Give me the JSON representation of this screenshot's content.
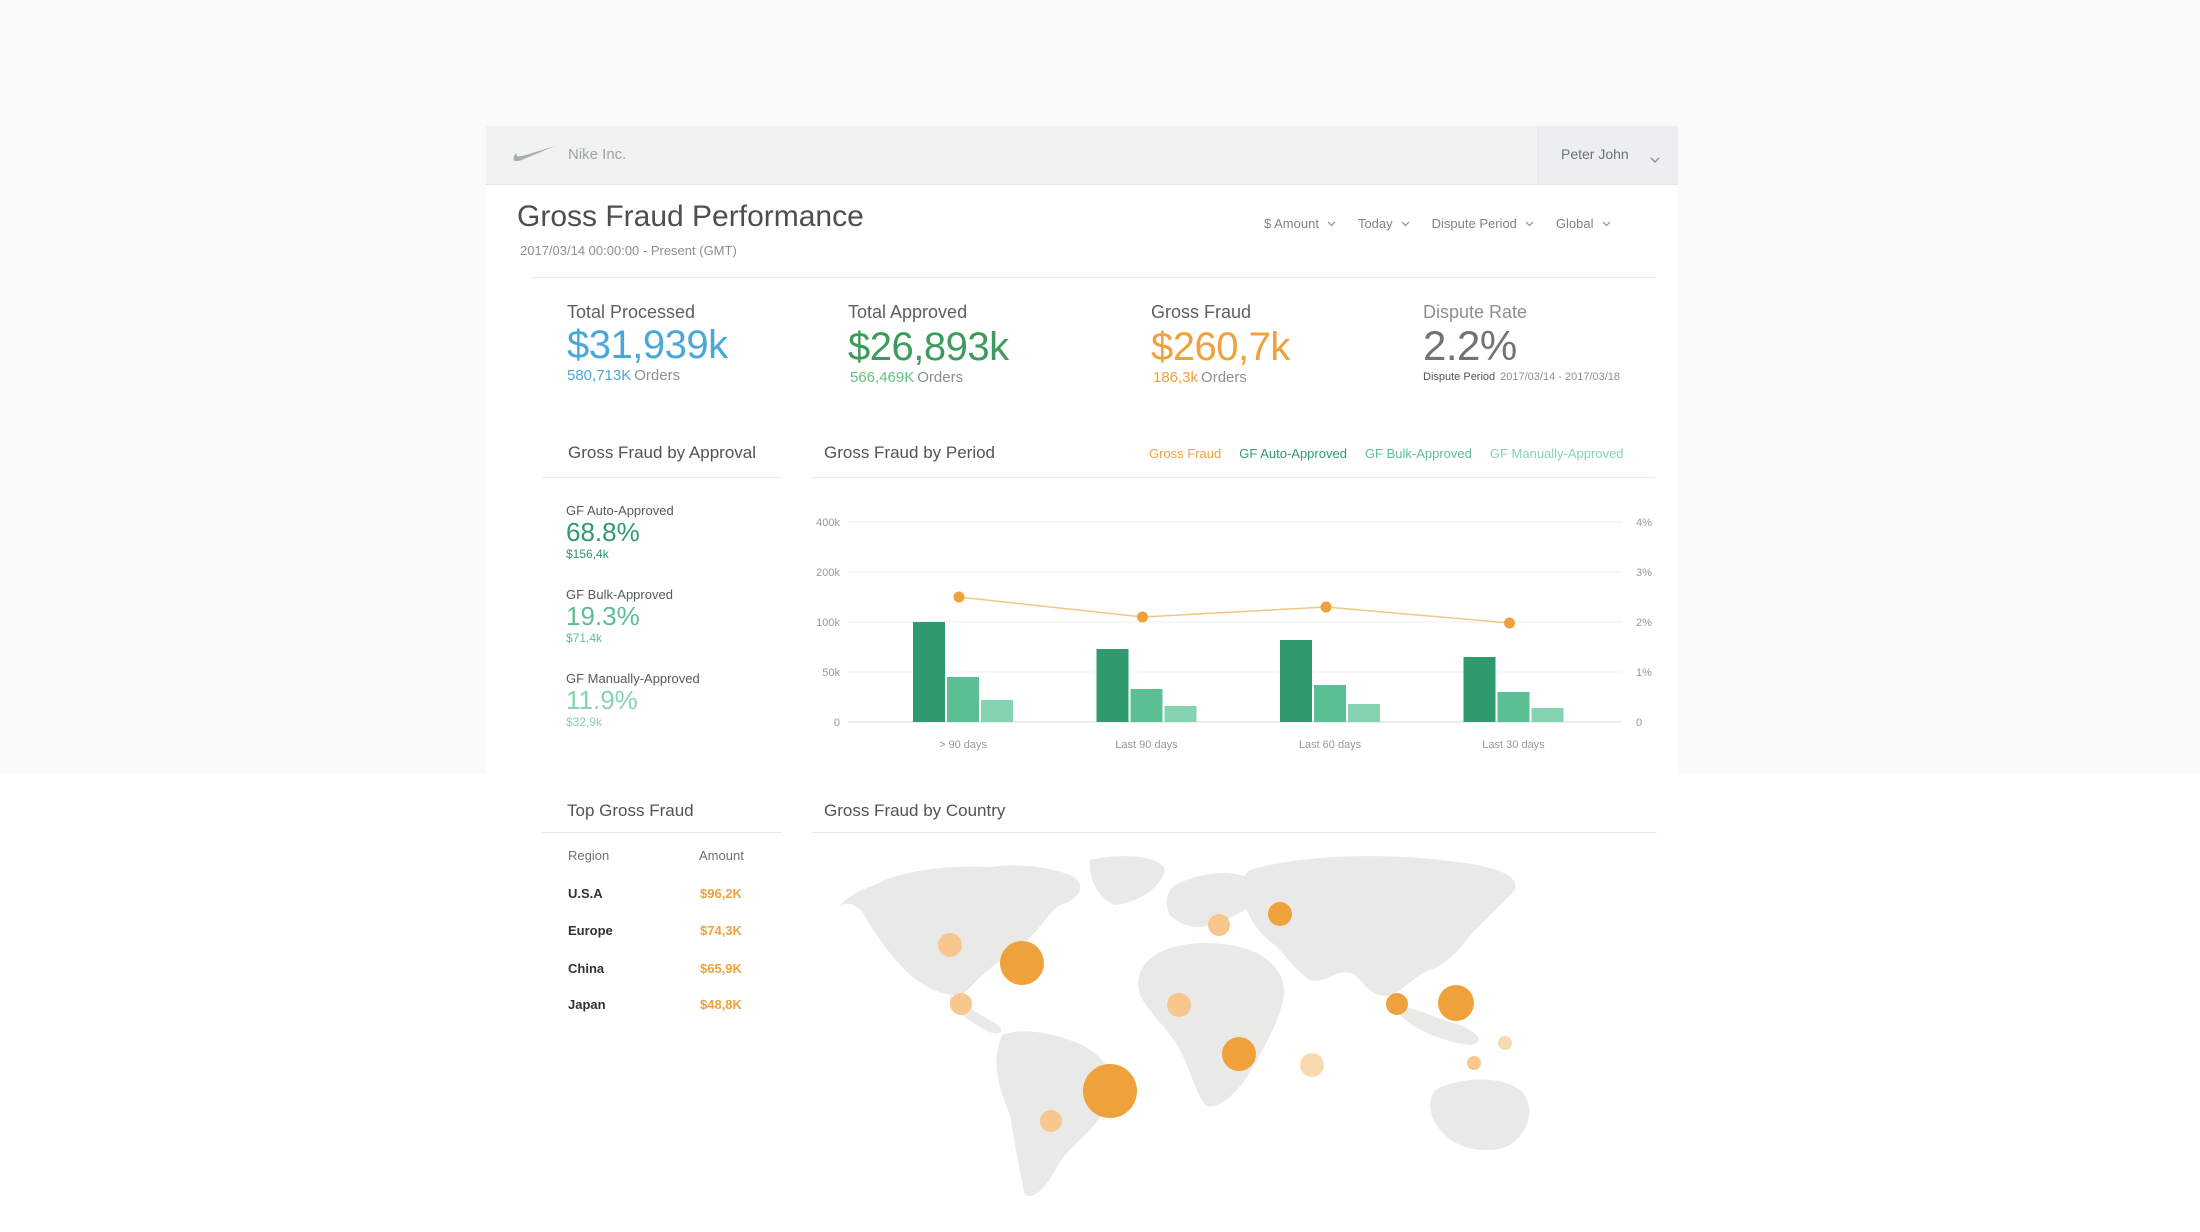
{
  "header": {
    "company": "Nike Inc.",
    "user": "Peter John"
  },
  "page": {
    "title": "Gross Fraud Performance",
    "subtitle": "2017/03/14 00:00:00 - Present (GMT)"
  },
  "filters": [
    {
      "label": "$ Amount"
    },
    {
      "label": "Today"
    },
    {
      "label": "Dispute Period"
    },
    {
      "label": "Global"
    }
  ],
  "kpis": {
    "total_processed": {
      "label": "Total Processed",
      "value": "$31,939k",
      "count": "580,713K",
      "unit": "Orders",
      "color": "#4aa8d8"
    },
    "total_approved": {
      "label": "Total Approved",
      "value": "$26,893k",
      "count": "566,469K",
      "unit": "Orders",
      "color": "#3f9b5c"
    },
    "gross_fraud": {
      "label": "Gross Fraud",
      "value": "$260,7k",
      "count": "186,3k",
      "unit": "Orders",
      "color": "#efa13c"
    },
    "dispute_rate": {
      "label": "Dispute Rate",
      "value": "2.2%",
      "period_label": "Dispute Period",
      "period": "2017/03/14 - 2017/03/18",
      "color": "#6f7577"
    }
  },
  "approval": {
    "title": "Gross Fraud by Approval",
    "items": [
      {
        "label": "GF Auto-Approved",
        "pct": "68.8%",
        "amount": "$156,4k",
        "color": "#2f9a6d"
      },
      {
        "label": "GF Bulk-Approved",
        "pct": "19.3%",
        "amount": "$71,4k",
        "color": "#5cbf93"
      },
      {
        "label": "GF Manually-Approved",
        "pct": "11.9%",
        "amount": "$32,9k",
        "color": "#86d3b1"
      }
    ]
  },
  "period": {
    "title": "Gross Fraud by Period",
    "legend": [
      {
        "label": "Gross Fraud",
        "color": "#efa13c"
      },
      {
        "label": "GF Auto-Approved",
        "color": "#2f9a6d"
      },
      {
        "label": "GF Bulk-Approved",
        "color": "#5cbf93"
      },
      {
        "label": "GF Manually-Approved",
        "color": "#86d3b1"
      }
    ]
  },
  "chart_data": {
    "type": "bar",
    "categories": [
      "> 90 days",
      "Last 90 days",
      "Last 60 days",
      "Last 30 days"
    ],
    "y_ticks": [
      "400k",
      "200k",
      "100k",
      "50k",
      "0"
    ],
    "y2_ticks": [
      "4%",
      "3%",
      "2%",
      "1%",
      "0"
    ],
    "series": [
      {
        "name": "GF Auto-Approved",
        "values": [
          100,
          73,
          82,
          65
        ],
        "color": "#2f9a6d"
      },
      {
        "name": "GF Bulk-Approved",
        "values": [
          45,
          33,
          37,
          30
        ],
        "color": "#5cbf93"
      },
      {
        "name": "GF Manually-Approved",
        "values": [
          22,
          16,
          18,
          14
        ],
        "color": "#86d3b1"
      }
    ],
    "line": {
      "name": "Gross Fraud",
      "values": [
        2.5,
        2.1,
        2.3,
        1.98
      ],
      "color": "#efa13c",
      "axis": "right"
    }
  },
  "top_fraud": {
    "title": "Top Gross Fraud",
    "columns": [
      "Region",
      "Amount"
    ],
    "rows": [
      {
        "region": "U.S.A",
        "amount": "$96,2K"
      },
      {
        "region": "Europe",
        "amount": "$74,3K"
      },
      {
        "region": "China",
        "amount": "$65,9K"
      },
      {
        "region": "Japan",
        "amount": "$48,8K"
      }
    ]
  },
  "country": {
    "title": "Gross Fraud by Country"
  }
}
